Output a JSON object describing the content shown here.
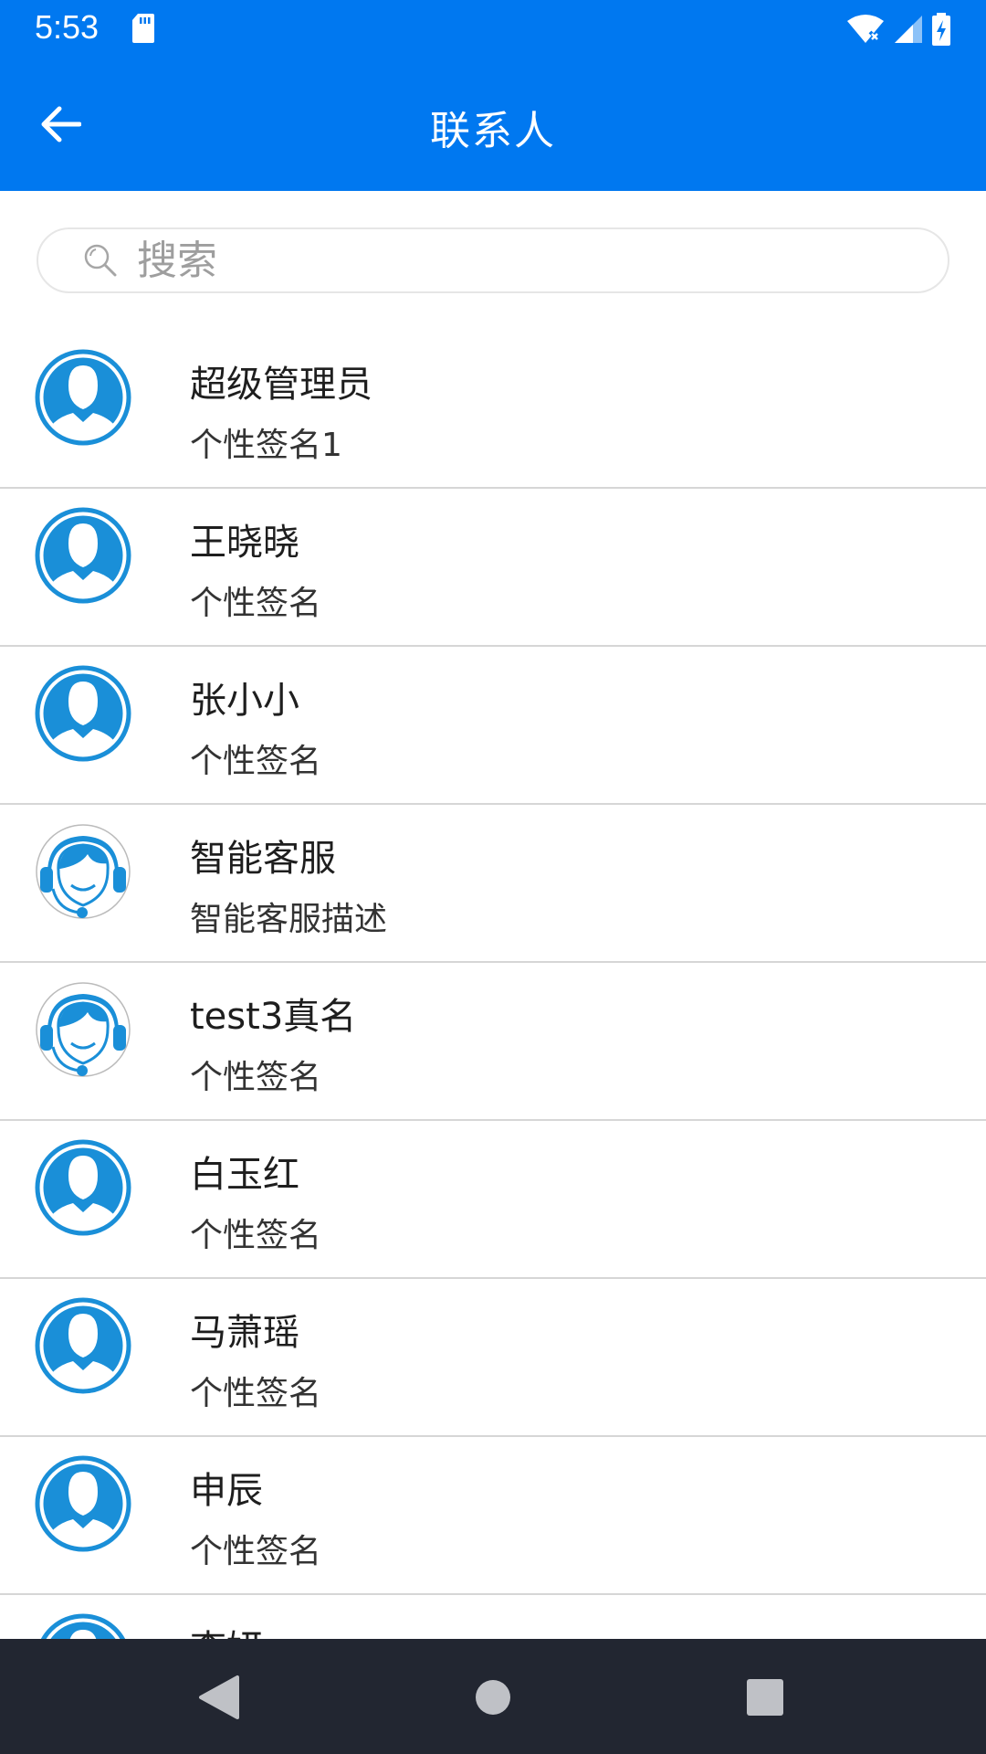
{
  "status_bar": {
    "time": "5:53",
    "icons": [
      "sd-card-icon",
      "wifi-icon",
      "signal-icon",
      "battery-charging-icon"
    ]
  },
  "app_bar": {
    "title": "联系人",
    "back_icon": "arrow-left-icon"
  },
  "search": {
    "placeholder": "搜索",
    "value": ""
  },
  "contacts": [
    {
      "name": "超级管理员",
      "signature": "个性签名1",
      "avatar": "person-avatar-icon"
    },
    {
      "name": "王晓晓",
      "signature": "个性签名",
      "avatar": "person-avatar-icon"
    },
    {
      "name": "张小小",
      "signature": "个性签名",
      "avatar": "person-avatar-icon"
    },
    {
      "name": "智能客服",
      "signature": "智能客服描述",
      "avatar": "support-agent-avatar-icon"
    },
    {
      "name": "test3真名",
      "signature": "个性签名",
      "avatar": "support-agent-avatar-icon"
    },
    {
      "name": "白玉红",
      "signature": "个性签名",
      "avatar": "person-avatar-icon"
    },
    {
      "name": "马萧瑶",
      "signature": "个性签名",
      "avatar": "person-avatar-icon"
    },
    {
      "name": "申辰",
      "signature": "个性签名",
      "avatar": "person-avatar-icon"
    },
    {
      "name": "李妍",
      "signature": "",
      "avatar": "person-avatar-icon"
    }
  ],
  "nav_bar": {
    "buttons": [
      "back-triangle-icon",
      "home-circle-icon",
      "recents-square-icon"
    ]
  },
  "colors": {
    "primary": "#0078f0",
    "avatar_blue": "#1a8fd8",
    "nav_bar": "#222631",
    "divider": "#d6d6d6"
  }
}
